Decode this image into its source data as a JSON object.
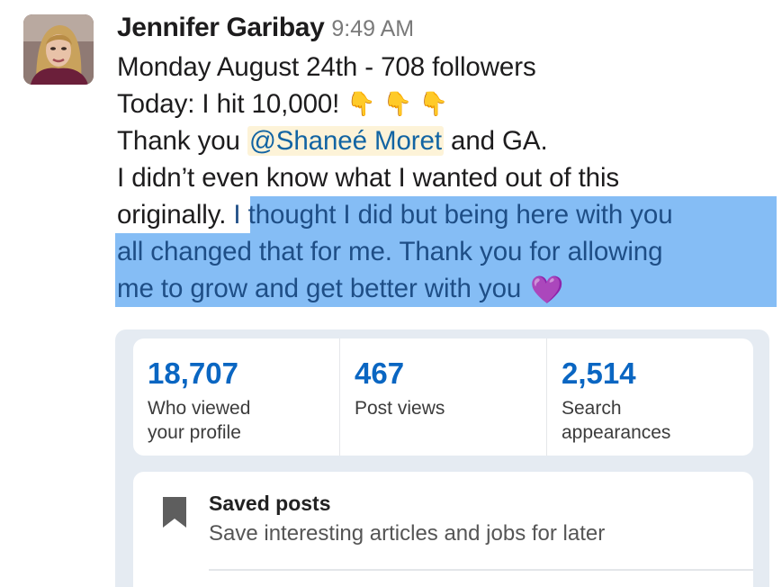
{
  "message": {
    "author": "Jennifer Garibay",
    "time": "9:49 AM",
    "line1": "Monday August 24th - 708 followers",
    "line2": "Today: I hit 10,000!",
    "line3_pre": "Thank you ",
    "mention": "@Shaneé Moret",
    "line3_post": " and GA.",
    "line4": "I didn’t even know what I wanted out of this",
    "line5_plain": "originally.",
    "line5_hl": " I thought I did but being here with you",
    "line6": "all changed that for me. Thank you for allowing",
    "line7": "me to grow and get better with you",
    "emoji_hand": "👇",
    "emoji_heart": "💜"
  },
  "stats": [
    {
      "value": "18,707",
      "label": "Who viewed\nyour profile"
    },
    {
      "value": "467",
      "label": "Post views"
    },
    {
      "value": "2,514",
      "label": "Search\nappearances"
    }
  ],
  "saved": {
    "title": "Saved posts",
    "description": "Save interesting articles and jobs for later",
    "icon": "bookmark-icon"
  },
  "colors": {
    "link": "#1264a3",
    "stat_value": "#0a66c2",
    "highlight": "#85bdf5",
    "card_bg": "#e5ebf2"
  }
}
